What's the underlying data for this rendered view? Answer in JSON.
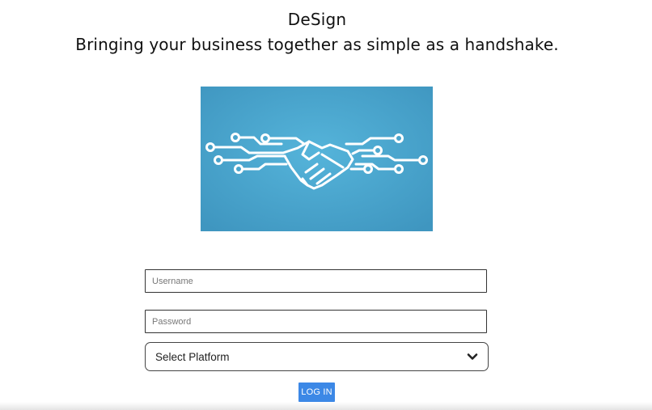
{
  "header": {
    "title": "DeSign",
    "tagline": "Bringing your business together as simple as a handshake."
  },
  "hero": {
    "icon": "circuit-handshake-icon",
    "background_color": "#4ba7cf"
  },
  "form": {
    "username_placeholder": "Username",
    "password_placeholder": "Password",
    "platform_selected": "Select Platform",
    "login_label": "LOG IN"
  },
  "colors": {
    "accent": "#3c88e6",
    "text": "#111111"
  }
}
